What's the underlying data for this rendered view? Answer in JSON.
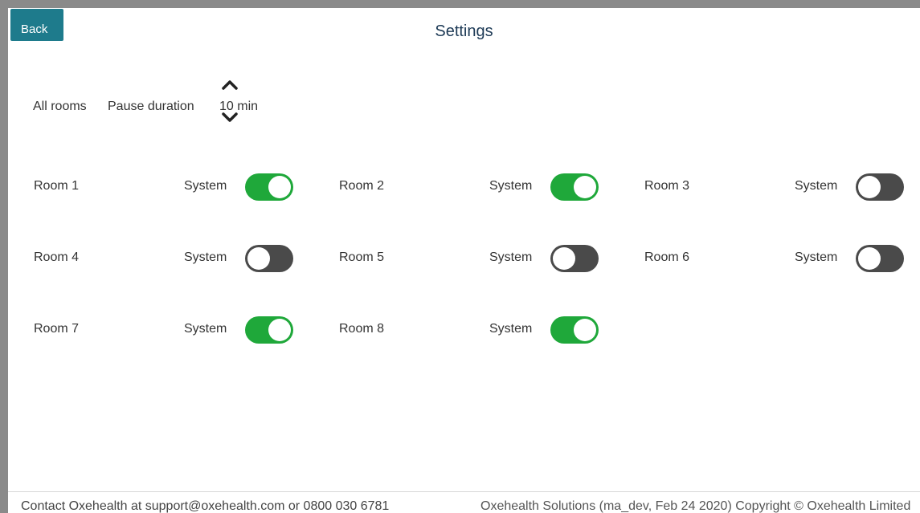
{
  "header": {
    "back_label": "Back",
    "title": "Settings"
  },
  "pause": {
    "all_rooms_label": "All rooms",
    "duration_label": "Pause duration",
    "duration_value": "10 min",
    "up_icon": "chevron-up-icon",
    "down_icon": "chevron-down-icon"
  },
  "rooms": [
    {
      "name": "Room 1",
      "toggle_label": "System",
      "enabled": true
    },
    {
      "name": "Room 2",
      "toggle_label": "System",
      "enabled": true
    },
    {
      "name": "Room 3",
      "toggle_label": "System",
      "enabled": false
    },
    {
      "name": "Room 4",
      "toggle_label": "System",
      "enabled": false
    },
    {
      "name": "Room 5",
      "toggle_label": "System",
      "enabled": false
    },
    {
      "name": "Room 6",
      "toggle_label": "System",
      "enabled": false
    },
    {
      "name": "Room 7",
      "toggle_label": "System",
      "enabled": true
    },
    {
      "name": "Room 8",
      "toggle_label": "System",
      "enabled": true
    }
  ],
  "footer": {
    "contact": "Contact Oxehealth at support@oxehealth.com or 0800 030 6781",
    "copyright": "Oxehealth Solutions (ma_dev, Feb 24 2020) Copyright © Oxehealth Limited"
  },
  "colors": {
    "accent": "#1e7b8c",
    "toggle_on": "#1fa83a",
    "toggle_off": "#4a4a4a",
    "title": "#1d3a56"
  }
}
